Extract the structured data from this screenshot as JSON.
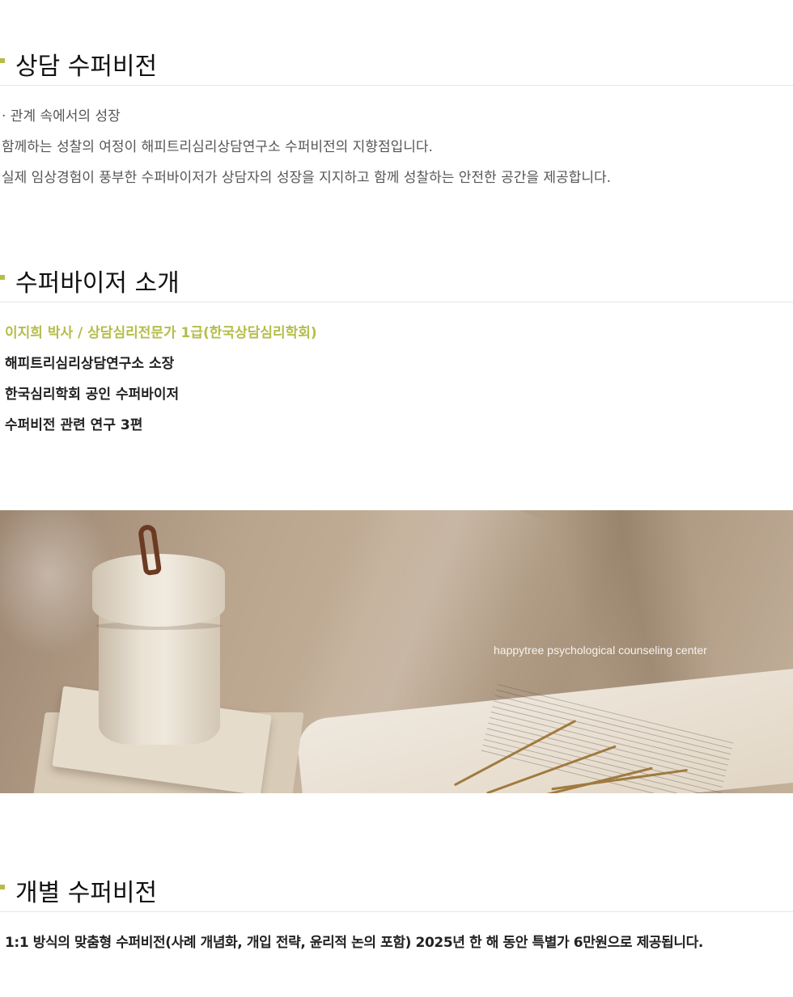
{
  "sections": {
    "supervision": {
      "title": "상담 수퍼비전",
      "lines": [
        "· 관계 속에서의 성장",
        "함께하는 성찰의 여정이 해피트리심리상담연구소 수퍼비전의 지향점입니다.",
        "실제 임상경험이 풍부한 수퍼바이저가 상담자의 성장을 지지하고 함께 성찰하는 안전한 공간을 제공합니다."
      ]
    },
    "supervisor": {
      "title": "수퍼바이저 소개",
      "headline": "이지희 박사 / 상담심리전문가 1급(한국상담심리학회)",
      "lines": [
        "해피트리심리상담연구소 소장",
        "한국심리학회 공인 수퍼바이저",
        "수퍼비전 관련 연구 3편"
      ]
    },
    "banner": {
      "caption": "happytree psychological counseling center"
    },
    "individual": {
      "title": "개별 수퍼비전",
      "text": "1:1 방식의 맞춤형 수퍼비전(사례 개념화, 개입 전략, 윤리적 논의 포함) 2025년 한 해 동안 특별가 6만원으로 제공됩니다."
    }
  },
  "colors": {
    "accent": "#b5bd4a",
    "text": "#555555",
    "heading": "#111111"
  }
}
